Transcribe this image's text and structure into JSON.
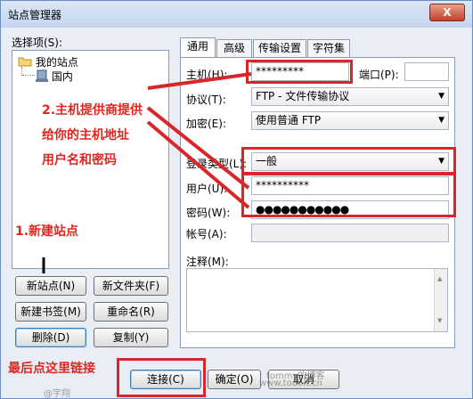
{
  "window": {
    "title": "站点管理器",
    "close_glyph": "X"
  },
  "left": {
    "select_label": "选择项(S):",
    "tree": {
      "root": "我的站点",
      "child": "国内"
    }
  },
  "buttons": {
    "new_site": "新站点(N)",
    "new_folder": "新文件夹(F)",
    "new_bookmark": "新建书签(M)",
    "rename": "重命名(R)",
    "delete": "删除(D)",
    "copy": "复制(Y)",
    "connect": "连接(C)",
    "ok": "确定(O)",
    "cancel": "取消"
  },
  "tabs": [
    "通用",
    "高级",
    "传输设置",
    "字符集"
  ],
  "form": {
    "host_label": "主机(H):",
    "host_value": "*********",
    "port_label": "端口(P):",
    "port_value": "",
    "protocol_label": "协议(T):",
    "protocol_value": "FTP - 文件传输协议",
    "encryption_label": "加密(E):",
    "encryption_value": "使用普通 FTP",
    "logon_label": "登录类型(L):",
    "logon_value": "一般",
    "user_label": "用户(U):",
    "user_value": "**********",
    "password_label": "密码(W):",
    "password_value": "●●●●●●●●●●●",
    "account_label": "帐号(A):",
    "comment_label": "注释(M):"
  },
  "annotations": {
    "step2_line1": "2.主机提供商提供",
    "step2_line2": "给你的主机地址",
    "step2_line3": "用户名和密码",
    "step1": "1.新建站点",
    "final": "最后点这里链接"
  },
  "watermark": {
    "text1": "tommy的博客",
    "text2": "www.todoit.cn",
    "text3": "@宇翔"
  },
  "colors": {
    "annotation": "#e0261f",
    "frame": "#6b8fc3"
  }
}
